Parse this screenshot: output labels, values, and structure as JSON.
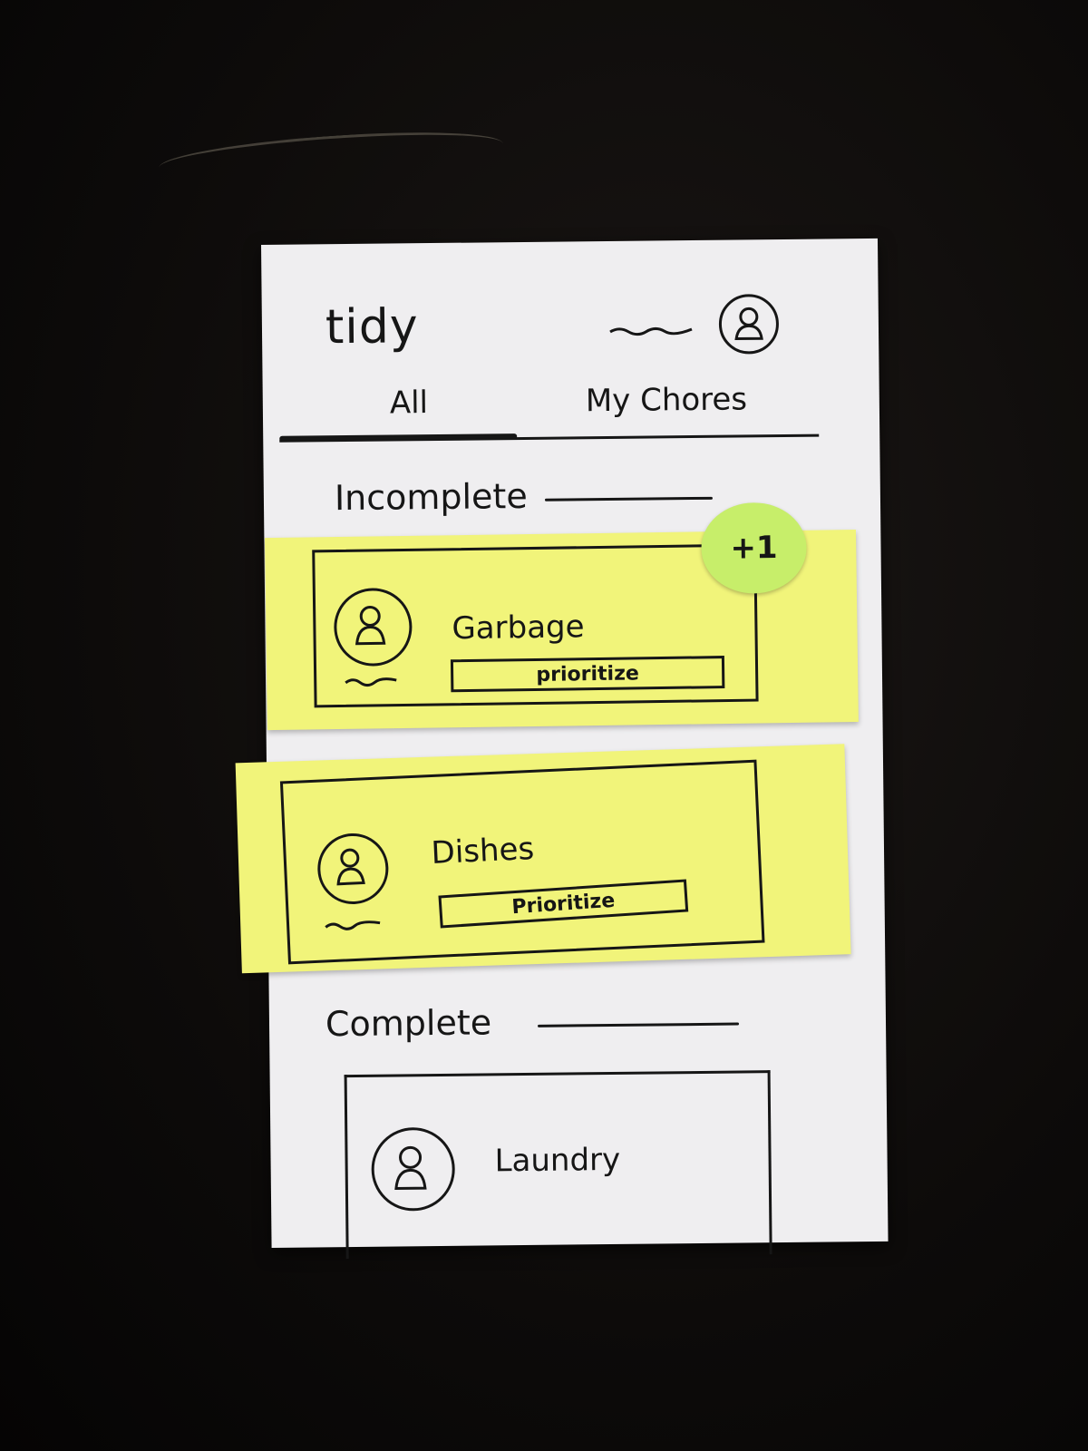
{
  "app": {
    "title": "tidy"
  },
  "header": {
    "profile_icon": "person-icon"
  },
  "tabs": [
    {
      "label": "All",
      "active": true
    },
    {
      "label": "My Chores",
      "active": false
    }
  ],
  "sections": {
    "incomplete": {
      "title": "Incomplete",
      "chores": [
        {
          "name": "Garbage",
          "action_label": "prioritize",
          "badge": "+1"
        },
        {
          "name": "Dishes",
          "action_label": "Prioritize"
        }
      ]
    },
    "complete": {
      "title": "Complete",
      "chores": [
        {
          "name": "Laundry"
        }
      ]
    }
  },
  "colors": {
    "sticky_note": "#f1f47a",
    "badge": "#c7ee6a",
    "paper": "#efeef0",
    "ink": "#161616"
  }
}
